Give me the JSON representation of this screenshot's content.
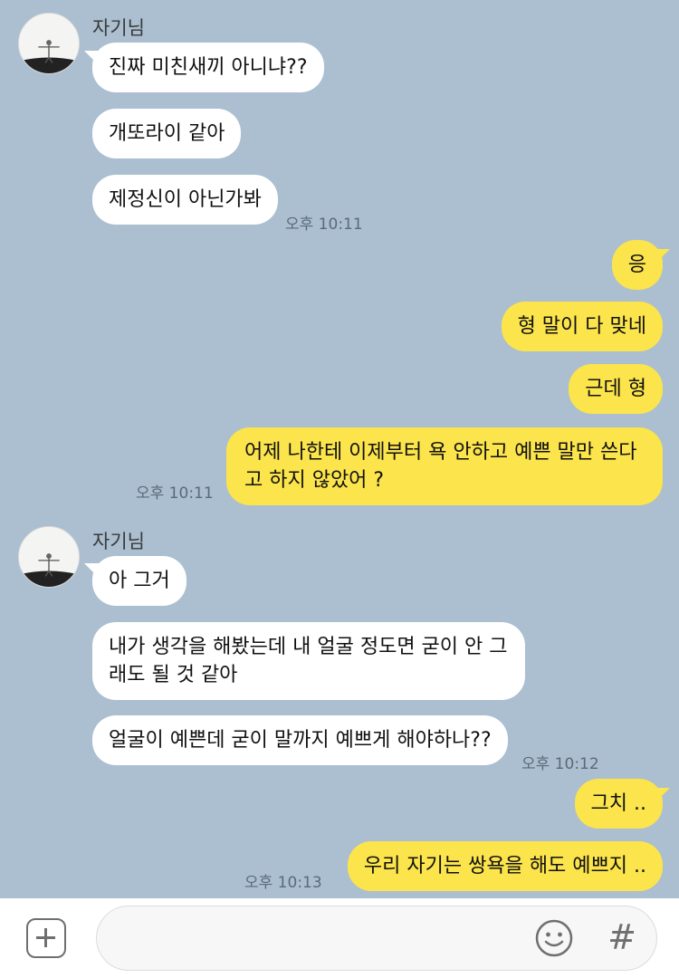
{
  "groups": [
    {
      "sender": "자기님",
      "messages": [
        "진짜 미친새끼 아니냐??",
        "개또라이 같아",
        "제정신이 아닌가봐"
      ],
      "time": "오후 10:11"
    },
    {
      "sender": "me",
      "messages": [
        "응",
        "형 말이 다 맞네",
        "근데 형",
        "어제 나한테 이제부터 욕 안하고 예쁜 말만 쓴다고 하지 않았어 ?"
      ],
      "time": "오후 10:11"
    },
    {
      "sender": "자기님",
      "messages": [
        "아 그거",
        "내가 생각을 해봤는데 내 얼굴 정도면 굳이 안 그래도 될 것 같아",
        "얼굴이 예쁜데 굳이 말까지 예쁘게 해야하나??"
      ],
      "time": "오후 10:12"
    },
    {
      "sender": "me",
      "messages": [
        "그치 ..",
        "우리 자기는 쌍욕을 해도 예쁘지 .."
      ],
      "time": "오후 10:13"
    }
  ],
  "input": {
    "value": "",
    "placeholder": ""
  },
  "icons": {
    "plus": "plus-square-icon",
    "emoji": "smiley-icon",
    "hash": "hash-icon"
  },
  "hash_glyph": "#",
  "colors": {
    "background": "#abbfd0",
    "incoming": "#ffffff",
    "outgoing": "#fbe44c"
  }
}
